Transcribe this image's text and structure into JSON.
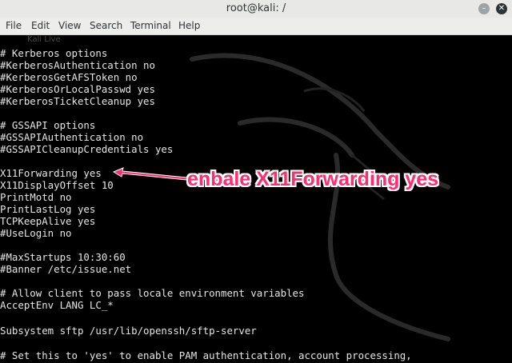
{
  "window": {
    "title": "root@kali: /"
  },
  "titlebar_icons": {
    "minimize": "minimize-icon",
    "close": "close-icon",
    "minimize_glyph": "–",
    "close_glyph": "✕"
  },
  "menubar": {
    "items": [
      "File",
      "Edit",
      "View",
      "Search",
      "Terminal",
      "Help"
    ]
  },
  "terminal": {
    "ghost_tab": "Kali Live",
    "lines": [
      "# Kerberos options",
      "#KerberosAuthentication no",
      "#KerberosGetAFSToken no",
      "#KerberosOrLocalPasswd yes",
      "#KerberosTicketCleanup yes",
      "",
      "# GSSAPI options",
      "#GSSAPIAuthentication no",
      "#GSSAPICleanupCredentials yes",
      "",
      "X11Forwarding yes",
      "X11DisplayOffset 10",
      "PrintMotd no",
      "PrintLastLog yes",
      "TCPKeepAlive yes",
      "#UseLogin no",
      "",
      "#MaxStartups 10:30:60",
      "#Banner /etc/issue.net",
      "",
      "# Allow client to pass locale environment variables",
      "AcceptEnv LANG LC_*",
      "",
      "Subsystem sftp /usr/lib/openssh/sftp-server",
      "",
      "# Set this to 'yes' to enable PAM authentication, account processing,"
    ]
  },
  "annotation": {
    "text": "enbale X11Forwarding yes",
    "color": "#ff2d6f",
    "outline_color": "#ffffff"
  },
  "colors": {
    "terminal_bg": "#000000",
    "terminal_fg": "#e6e6e6",
    "titlebar_bg": "#e8e8e7"
  }
}
